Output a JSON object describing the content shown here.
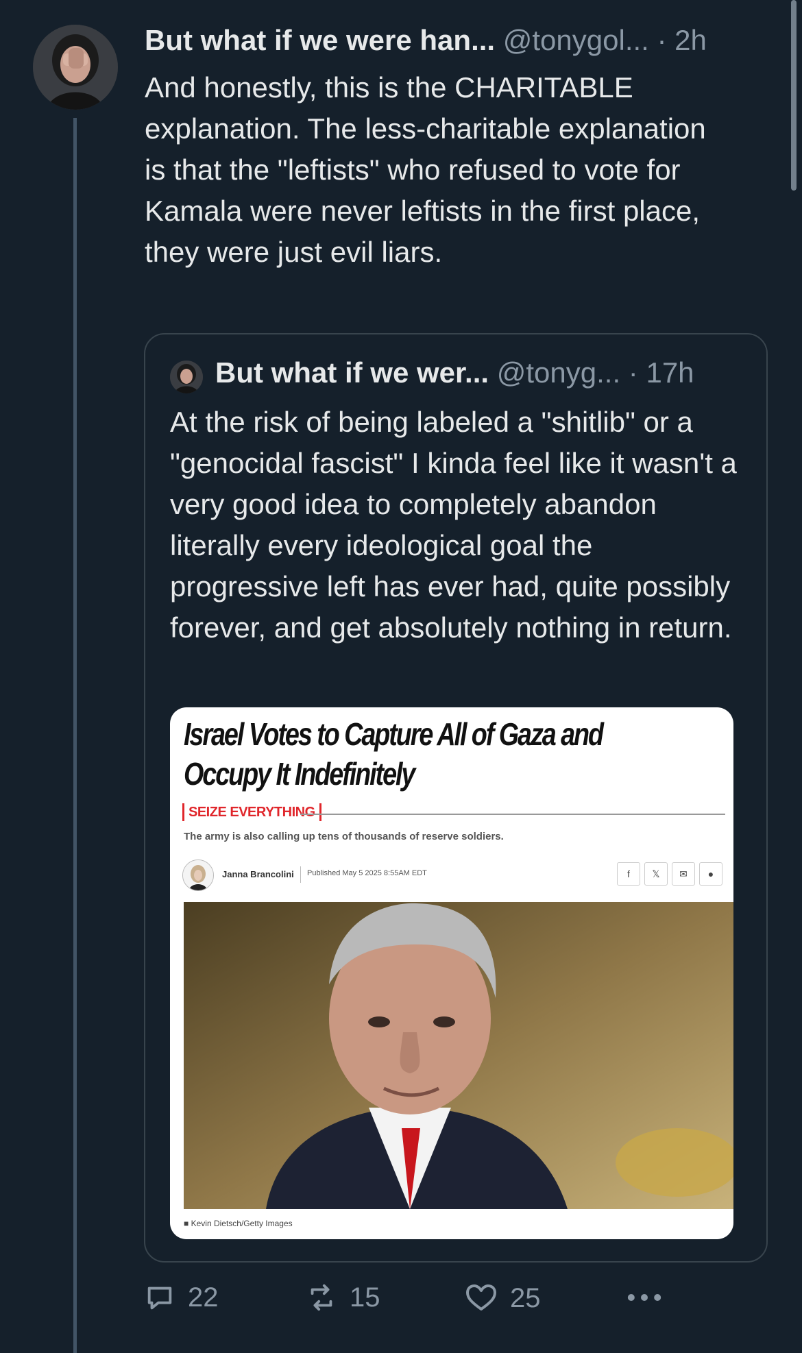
{
  "tweet": {
    "author_name": "But what if we were han...",
    "author_handle": "@tonygol...",
    "separator": "·",
    "time": "2h",
    "text": "And honestly, this is the CHARITABLE explanation. The less-charitable explanation is that the \"leftists\" who refused to vote for Kamala were never leftists in the first place, they were just evil liars."
  },
  "quote": {
    "author_name": "But what if we wer...",
    "author_handle": "@tonyg...",
    "separator": "·",
    "time": "17h",
    "text": "At the risk of being labeled a \"shitlib\" or a \"genocidal fascist\" I kinda feel like it wasn't a very good idea to completely abandon literally every ideological goal the progressive left has ever had, quite possibly forever, and get absolutely nothing in return.",
    "article": {
      "headline": "Israel Votes to Capture All of Gaza and Occupy It Indefinitely",
      "kicker": "SEIZE EVERYTHING",
      "dek": "The army is also calling up tens of thousands of reserve soldiers.",
      "author": "Janna Brancolini",
      "published": "Published May 5 2025 8:55AM EDT",
      "share_icons": [
        "facebook-icon",
        "x-icon",
        "email-icon",
        "reddit-icon"
      ],
      "share_glyphs": [
        "f",
        "𝕏",
        "✉",
        "●"
      ],
      "photo_credit": "Kevin Dietsch/Getty Images"
    }
  },
  "actions": {
    "replies": "22",
    "retweets": "15",
    "likes": "25"
  },
  "colors": {
    "background": "#15202b",
    "text": "#e7e9ea",
    "muted": "#8b98a5",
    "border": "#38444d",
    "accent_red": "#e0262b"
  }
}
